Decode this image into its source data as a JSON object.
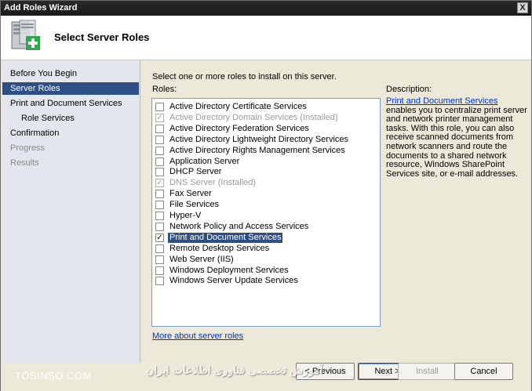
{
  "window": {
    "title": "Add Roles Wizard",
    "close_symbol": "X"
  },
  "header": {
    "title": "Select Server Roles",
    "icon": "server-add-icon"
  },
  "sidebar": {
    "items": [
      {
        "label": "Before You Begin",
        "state": "normal"
      },
      {
        "label": "Server Roles",
        "state": "active"
      },
      {
        "label": "Print and Document Services",
        "state": "normal"
      },
      {
        "label": "Role Services",
        "state": "sub"
      },
      {
        "label": "Confirmation",
        "state": "normal"
      },
      {
        "label": "Progress",
        "state": "disabled"
      },
      {
        "label": "Results",
        "state": "disabled"
      }
    ]
  },
  "main": {
    "instruction": "Select one or more roles to install on this server.",
    "roles_label": "Roles:",
    "roles": [
      {
        "label": "Active Directory Certificate Services",
        "checked": false,
        "disabled": false
      },
      {
        "label": "Active Directory Domain Services  (Installed)",
        "checked": true,
        "disabled": true
      },
      {
        "label": "Active Directory Federation Services",
        "checked": false,
        "disabled": false
      },
      {
        "label": "Active Directory Lightweight Directory Services",
        "checked": false,
        "disabled": false
      },
      {
        "label": "Active Directory Rights Management Services",
        "checked": false,
        "disabled": false
      },
      {
        "label": "Application Server",
        "checked": false,
        "disabled": false
      },
      {
        "label": "DHCP Server",
        "checked": false,
        "disabled": false
      },
      {
        "label": "DNS Server  (Installed)",
        "checked": true,
        "disabled": true
      },
      {
        "label": "Fax Server",
        "checked": false,
        "disabled": false
      },
      {
        "label": "File Services",
        "checked": false,
        "disabled": false
      },
      {
        "label": "Hyper-V",
        "checked": false,
        "disabled": false
      },
      {
        "label": "Network Policy and Access Services",
        "checked": false,
        "disabled": false
      },
      {
        "label": "Print and Document Services",
        "checked": true,
        "disabled": false,
        "selected": true
      },
      {
        "label": "Remote Desktop Services",
        "checked": false,
        "disabled": false
      },
      {
        "label": "Web Server (IIS)",
        "checked": false,
        "disabled": false
      },
      {
        "label": "Windows Deployment Services",
        "checked": false,
        "disabled": false
      },
      {
        "label": "Windows Server Update Services",
        "checked": false,
        "disabled": false
      }
    ],
    "more_link": "More about server roles",
    "description": {
      "title": "Description:",
      "link": "Print and Document Services",
      "text": " enables you to centralize print server and network printer management tasks. With this role, you can also receive scanned documents from network scanners and route the documents to a shared network resource, Windows SharePoint Services site, or e-mail addresses."
    }
  },
  "footer": {
    "previous": "< Previous",
    "next": "Next >",
    "install": "Install",
    "cancel": "Cancel"
  },
  "watermark": {
    "left": "TOSINSO.COM",
    "right": "آموزش تخصصی فناوری اطلاعات ایران"
  },
  "colors": {
    "accent": "#2d4f86",
    "link": "#0033cc",
    "background": "#ece9d8"
  }
}
